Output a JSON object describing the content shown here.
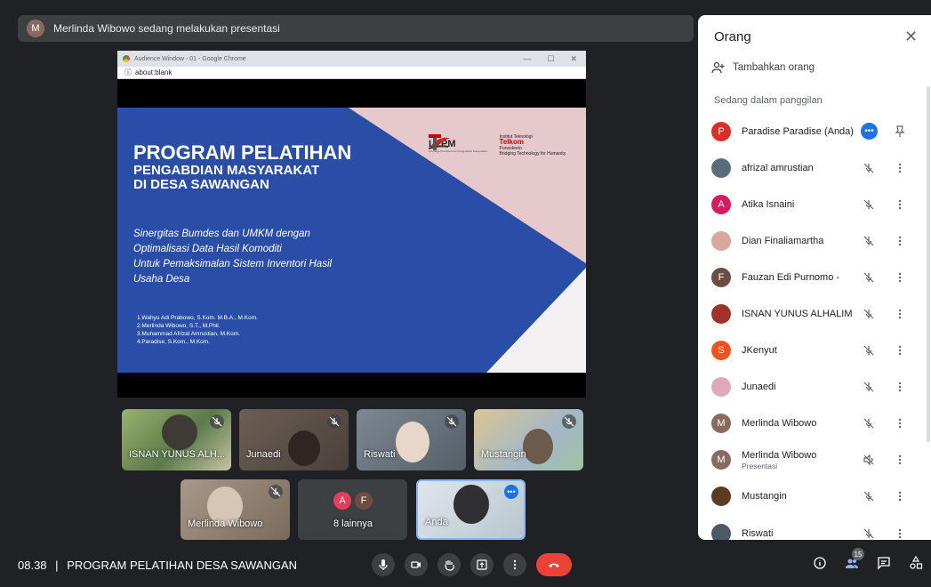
{
  "banner": {
    "avatar_letter": "M",
    "text": "Merlinda Wibowo sedang melakukan presentasi"
  },
  "presentation": {
    "window_title": "Audience Window - 01 - Google Chrome",
    "address": "about:blank",
    "slide": {
      "title": "PROGRAM PELATIHAN",
      "subtitle_1": "PENGABDIAN MASYARAKAT",
      "subtitle_2": "DI DESA SAWANGAN",
      "desc_1": "Sinergitas Bumdes dan UMKM dengan",
      "desc_2": "Optimalisasi Data Hasil Komoditi",
      "desc_3": "Untuk Pemaksimalan Sistem Inventori Hasil",
      "desc_4": "Usaha Desa",
      "authors": [
        "1.Wahyu Adi Prabowo, S.Kom. M.B.A., M.Kom.",
        "2.Merlinda Wibowo, S.T., M.Phil.",
        "3.Muhammad Afrizal Amrustian, M.Kom.",
        "4.Paradise, S.Kom., M.Kom."
      ],
      "logo_lppm": "LPPM",
      "logo_lppm_sub": "Lembaga Penelitian dan Pengabdian Masyarakat",
      "logo_telkom_top": "Institut Teknologi",
      "logo_telkom": "Telkom",
      "logo_telkom_city": "Purwokerto",
      "logo_telkom_tag": "Bridging Technology for Humanity"
    }
  },
  "tiles": [
    {
      "name": "ISNAN YUNUS ALH...",
      "bg": "#6f8a5a"
    },
    {
      "name": "Junaedi",
      "bg": "#5c5048"
    },
    {
      "name": "Riswati",
      "bg": "#6c7a86"
    },
    {
      "name": "Mustangin",
      "bg": "#b9a77e"
    },
    {
      "name": "Merlinda Wibowo",
      "bg": "#8c7a6a"
    },
    {
      "name": "8 lainnya",
      "avatars": [
        "A",
        "F"
      ]
    },
    {
      "name": "Anda",
      "bg": "#c9d3da"
    }
  ],
  "bottom": {
    "time": "08.38",
    "separator": "|",
    "meeting": "PROGRAM PELATIHAN DESA SAWANGAN",
    "participant_count": "15"
  },
  "panel": {
    "title": "Orang",
    "add_people": "Tambahkan orang",
    "section": "Sedang dalam panggilan",
    "people": [
      {
        "name": "Paradise Paradise (Anda)",
        "letter": "P",
        "color": "#d93025"
      },
      {
        "name": "afrizal amrustian",
        "letter": "",
        "color": "#5b6c7d"
      },
      {
        "name": "Atika Isnaini",
        "letter": "A",
        "color": "#d81b60"
      },
      {
        "name": "Dian Finaliamartha",
        "letter": "",
        "color": "#d9a6a0"
      },
      {
        "name": "Fauzan Edi Purnomo -",
        "letter": "F",
        "color": "#6d4c41"
      },
      {
        "name": "ISNAN YUNUS ALHALIM",
        "letter": "",
        "color": "#a3312a"
      },
      {
        "name": "JKenyut",
        "letter": "S",
        "color": "#f4511e"
      },
      {
        "name": "Junaedi",
        "letter": "",
        "color": "#e0a9b8"
      },
      {
        "name": "Merlinda Wibowo",
        "letter": "M",
        "color": "#8a6a5e"
      },
      {
        "name": "Merlinda Wibowo",
        "sub": "Presentasi",
        "letter": "M",
        "color": "#8a6a5e"
      },
      {
        "name": "Mustangin",
        "letter": "",
        "color": "#5d3a22"
      },
      {
        "name": "Riswati",
        "letter": "",
        "color": "#4c5a66"
      }
    ]
  }
}
